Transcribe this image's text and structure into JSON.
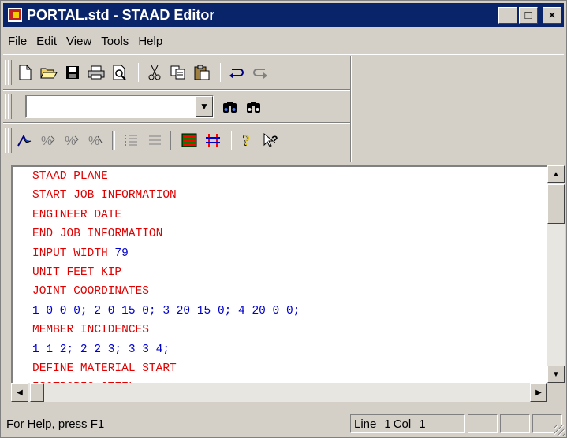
{
  "window": {
    "title": "PORTAL.std - STAAD Editor",
    "controls": {
      "minimize": "_",
      "maximize": "□",
      "close": "×"
    }
  },
  "menu": [
    "File",
    "Edit",
    "View",
    "Tools",
    "Help"
  ],
  "toolbar": {
    "row1": [
      "new-file-icon",
      "open-folder-icon",
      "save-icon",
      "print-icon",
      "print-preview-icon",
      "|",
      "cut-icon",
      "copy-icon",
      "paste-icon",
      "|",
      "undo-icon",
      "redo-icon"
    ],
    "row2": [
      "find-icon",
      "find-next-icon"
    ],
    "row3": [
      "indent-icon",
      "comment-icon",
      "uncomment-icon",
      "uncomment-all-icon",
      "|",
      "numbered-list-icon",
      "bullet-list-icon",
      "|",
      "calculator-icon",
      "swap-icon",
      "|",
      "help-icon",
      "context-help-icon"
    ]
  },
  "search": {
    "value": ""
  },
  "editor": {
    "lines": [
      {
        "text": "STAAD PLANE",
        "kind": "keyword"
      },
      {
        "text": "START JOB INFORMATION",
        "kind": "keyword"
      },
      {
        "text": "ENGINEER DATE",
        "kind": "keyword"
      },
      {
        "text": "END JOB INFORMATION",
        "kind": "keyword"
      },
      {
        "text": "INPUT WIDTH 79",
        "kind": "mixed"
      },
      {
        "text": "UNIT FEET KIP",
        "kind": "keyword"
      },
      {
        "text": "JOINT COORDINATES",
        "kind": "keyword"
      },
      {
        "text": "1 0 0 0; 2 0 15 0; 3 20 15 0; 4 20 0 0;",
        "kind": "number"
      },
      {
        "text": "MEMBER INCIDENCES",
        "kind": "keyword"
      },
      {
        "text": "1 1 2; 2 2 3; 3 3 4;",
        "kind": "number"
      },
      {
        "text": "DEFINE MATERIAL START",
        "kind": "keyword"
      },
      {
        "text": "ISOTROPIC STEEL",
        "kind": "keyword"
      }
    ],
    "colors": {
      "keyword": "#e00000",
      "number": "#0000cc"
    }
  },
  "status": {
    "help": "For Help, press F1",
    "line_label": "Line",
    "line_value": "1",
    "col_label": "Col",
    "col_value": "1"
  }
}
